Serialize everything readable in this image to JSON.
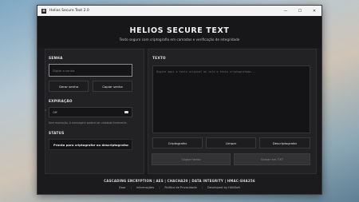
{
  "window": {
    "title": "Helios Secure Text 2.0",
    "icon_letter": "H"
  },
  "header": {
    "title": "HELIOS SECURE TEXT",
    "subtitle": "Texto seguro com criptografia em camadas e verificação de integridade"
  },
  "password": {
    "section": "SENHA",
    "placeholder": "Digite a senha",
    "generate_label": "Gerar senha",
    "copy_label": "Copiar senha"
  },
  "expiration": {
    "section": "EXPIRAÇÃO",
    "value": "Off",
    "hint": "Sem expiração. A mensagem poderá ser validada livremente."
  },
  "status": {
    "section": "STATUS",
    "text": "Pronto para criptografar ou descriptografar."
  },
  "text": {
    "section": "TEXTO",
    "placeholder": "Digite aqui o texto original ou cole o texto criptografado...",
    "encrypt_label": "Criptografar",
    "clear_label": "Limpar",
    "decrypt_label": "Descriptografar",
    "copy_label": "Copiar texto",
    "save_label": "Salvar em TXT"
  },
  "footer": {
    "title": "CASCADING ENCRYPTION | AES | CHACHA20 | DATA INTEGRITY | HMAC-SHA256",
    "links": [
      "Doar",
      "Informações",
      "Política de Privacidade",
      "Developed by HANSoft"
    ]
  }
}
